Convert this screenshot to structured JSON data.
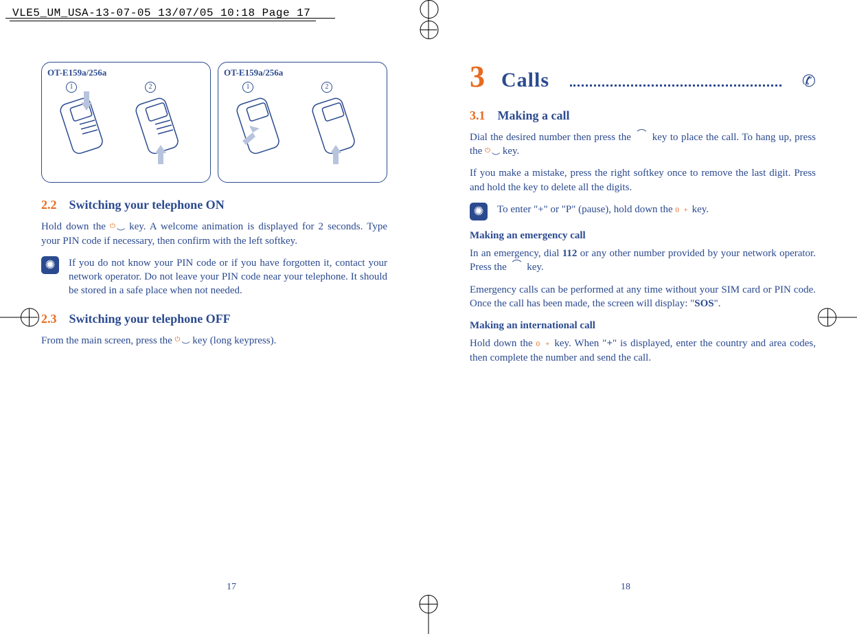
{
  "print_header": "VLE5_UM_USA-13-07-05  13/07/05  10:18  Page 17",
  "figures": {
    "label": "OT-E159a/256a",
    "step1": "1",
    "step2": "2"
  },
  "left": {
    "sec22_num": "2.2",
    "sec22_title": "Switching your telephone ON",
    "sec22_body_a": "Hold down the ",
    "sec22_body_b": " key. A welcome animation is displayed for 2 seconds. Type your PIN code if necessary, then confirm with the left softkey.",
    "tip22": "If you do not know your PIN code or if you have forgotten it, contact your network operator. Do not leave your PIN code near your telephone. It should be stored in a safe place when not needed.",
    "sec23_num": "2.3",
    "sec23_title": "Switching your telephone OFF",
    "sec23_body_a": "From the main screen, press the ",
    "sec23_body_b": " key (long keypress).",
    "page_num": "17"
  },
  "right": {
    "chapter_num": "3",
    "chapter_title": "Calls",
    "sec31_num": "3.1",
    "sec31_title": "Making a call",
    "p1_a": "Dial the desired number then press the ",
    "p1_b": " key to place the call. To hang up, press the ",
    "p1_c": " key.",
    "p2": "If you make a mistake, press the right softkey once to remove the last digit. Press and hold the key to delete all the digits.",
    "tip_a": "To enter \"+\" or \"P\" (pause), hold down the ",
    "tip_b": " key.",
    "sub_emerg": "Making an emergency call",
    "p3_a": "In an emergency, dial ",
    "p3_bold": "112",
    "p3_b": " or any other number provided by your network operator. Press the ",
    "p3_c": " key.",
    "p4_a": "Emergency calls can be performed at any time without your SIM card or PIN code. Once the call has been made, the screen will display: \"",
    "p4_bold": "SOS",
    "p4_b": "\".",
    "sub_intl": "Making an international call",
    "p5_a": "Hold down the ",
    "p5_b": " key. When \"",
    "p5_bold": "+",
    "p5_c": "\" is displayed, enter the country and area codes, then complete the number and send the call.",
    "zero_key": "0 +",
    "page_num": "18"
  }
}
